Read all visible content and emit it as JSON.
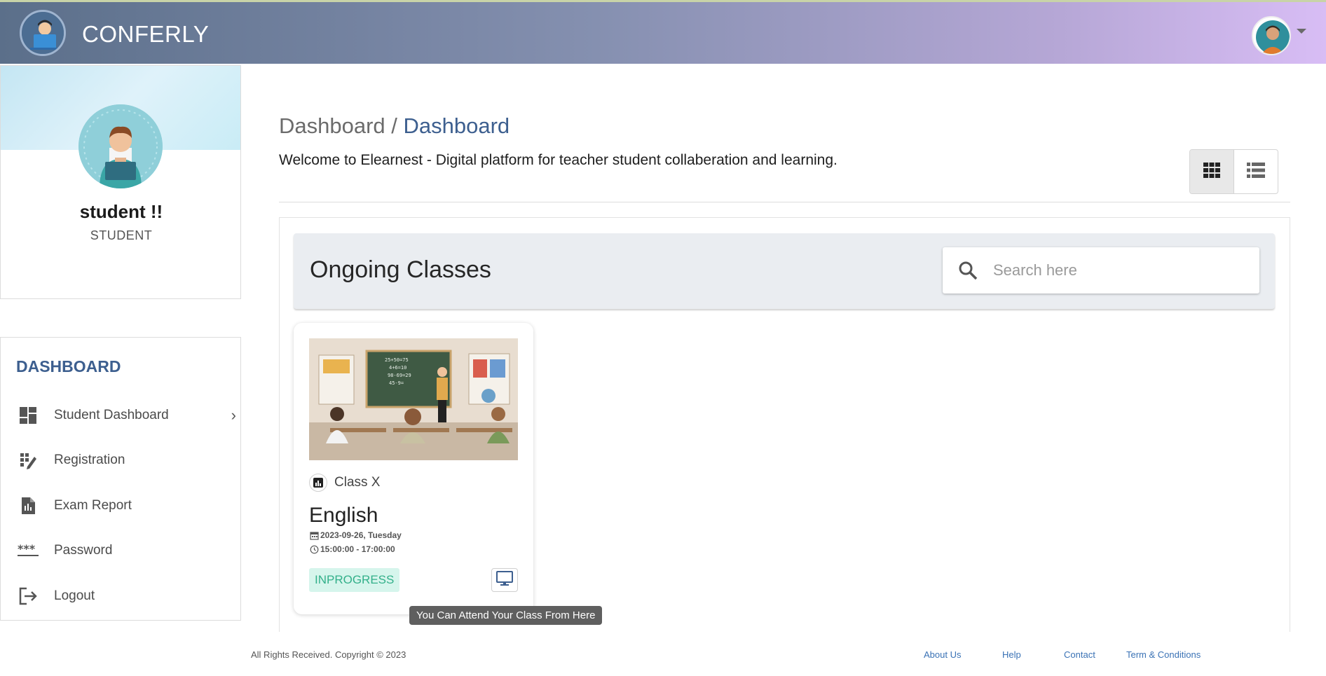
{
  "app": {
    "name": "CONFERLY"
  },
  "profile": {
    "name": "student !!",
    "role": "STUDENT"
  },
  "sidebar": {
    "title": "DASHBOARD",
    "items": [
      {
        "label": "Student Dashboard",
        "icon": "dashboard-icon"
      },
      {
        "label": "Registration",
        "icon": "registration-icon"
      },
      {
        "label": "Exam Report",
        "icon": "report-icon"
      },
      {
        "label": "Password",
        "icon": "password-icon"
      },
      {
        "label": "Logout",
        "icon": "logout-icon"
      }
    ]
  },
  "breadcrumb": {
    "parent": "Dashboard",
    "separator": " / ",
    "current": "Dashboard"
  },
  "welcome": "Welcome to Elearnest - Digital platform for teacher student collaberation and learning.",
  "panel": {
    "title": "Ongoing Classes",
    "search_placeholder": "Search here"
  },
  "class_card": {
    "grade": "Class X",
    "subject": "English",
    "date": "2023-09-26, Tuesday",
    "time": "15:00:00 - 17:00:00",
    "status": "INPROGRESS",
    "attend_tooltip": "You Can Attend Your Class From Here"
  },
  "footer": {
    "copyright": "All Rights Received. Copyright © 2023",
    "links": [
      "About Us",
      "Help",
      "Contact",
      "Term & Conditions"
    ]
  },
  "colors": {
    "accent": "#3d5f8f",
    "status_bg": "#d6f5ec",
    "status_text": "#33b08a",
    "link": "#3a72b5"
  }
}
